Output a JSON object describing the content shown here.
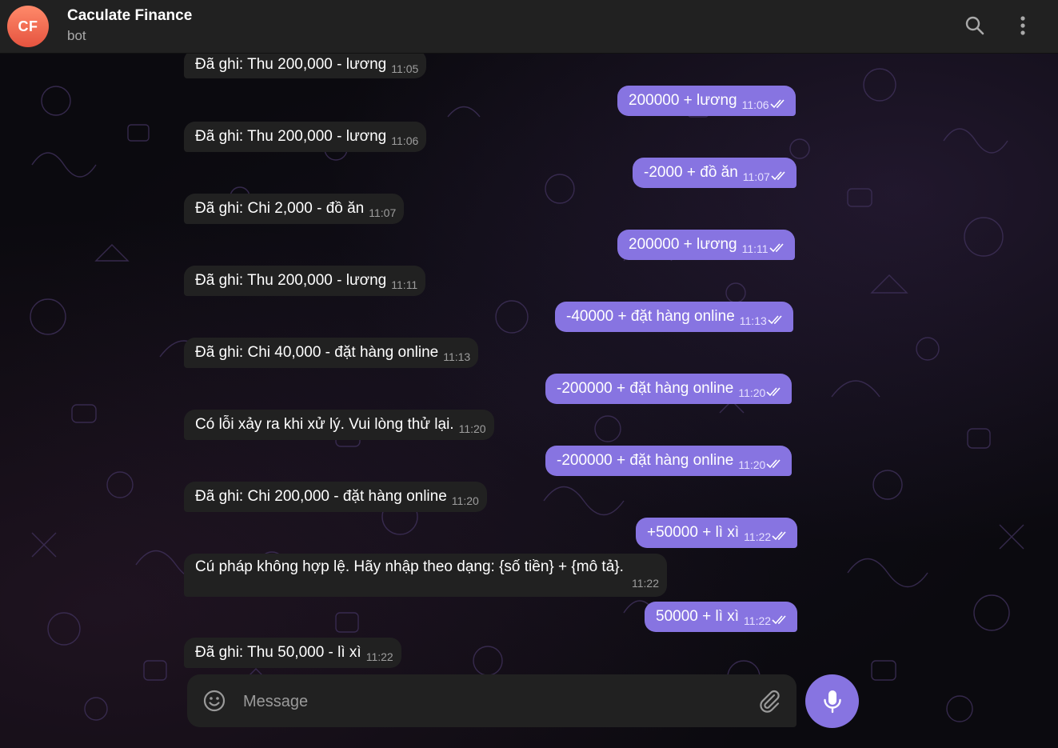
{
  "chat": {
    "initials": "CF",
    "title": "Caculate Finance",
    "subtitle": "bot",
    "avatar_color": "#e5533f"
  },
  "header_icons": [
    "search-icon",
    "more-vertical-icon"
  ],
  "messages": [
    {
      "dir": "in",
      "text": "Đã ghi: Thu 200,000 - lương",
      "time": "11:05"
    },
    {
      "dir": "out",
      "text": "200000 + lương",
      "time": "11:06"
    },
    {
      "dir": "in",
      "text": "Đã ghi: Thu 200,000 - lương",
      "time": "11:06"
    },
    {
      "dir": "out",
      "text": "-2000 + đồ ăn",
      "time": "11:07"
    },
    {
      "dir": "in",
      "text": "Đã ghi: Chi 2,000 - đồ ăn",
      "time": "11:07"
    },
    {
      "dir": "out",
      "text": "200000 + lương",
      "time": "11:11"
    },
    {
      "dir": "in",
      "text": "Đã ghi: Thu 200,000 - lương",
      "time": "11:11"
    },
    {
      "dir": "out",
      "text": "-40000 + đặt hàng online",
      "time": "11:13"
    },
    {
      "dir": "in",
      "text": "Đã ghi: Chi 40,000 - đặt hàng online",
      "time": "11:13"
    },
    {
      "dir": "out",
      "text": "-200000 + đặt hàng online",
      "time": "11:20"
    },
    {
      "dir": "in",
      "text": "Có lỗi xảy ra khi xử lý. Vui lòng thử lại.",
      "time": "11:20"
    },
    {
      "dir": "out",
      "text": "-200000 + đặt hàng online",
      "time": "11:20"
    },
    {
      "dir": "in",
      "text": "Đã ghi: Chi 200,000 - đặt hàng online",
      "time": "11:20"
    },
    {
      "dir": "out",
      "text": "+50000 + lì xì",
      "time": "11:22"
    },
    {
      "dir": "in",
      "text": "Cú pháp không hợp lệ. Hãy nhập theo dạng: {số tiền} + {mô tả}.",
      "time": "11:22"
    },
    {
      "dir": "out",
      "text": "50000 + lì xì",
      "time": "11:22"
    },
    {
      "dir": "in",
      "text": "Đã ghi: Thu 50,000 - lì xì",
      "time": "11:22"
    }
  ],
  "composer": {
    "placeholder": "Message",
    "value": ""
  },
  "colors": {
    "outgoing_bubble": "#8774e1",
    "incoming_bubble": "#212121",
    "header": "#212121"
  }
}
